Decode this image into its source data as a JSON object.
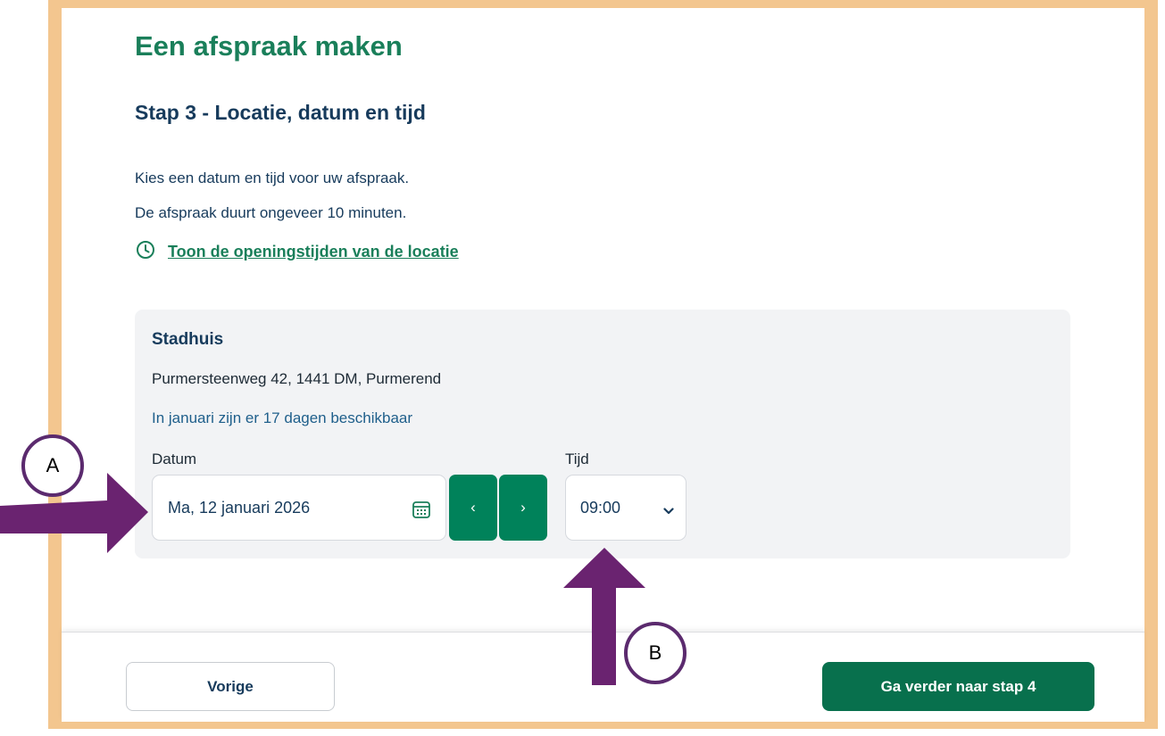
{
  "page": {
    "title": "Een afspraak maken",
    "step_title": "Stap 3 - Locatie, datum en tijd",
    "intro_lines": [
      "Kies een datum en tijd voor uw afspraak.",
      "De afspraak duurt ongeveer 10 minuten."
    ],
    "hours_link": "Toon de openingstijden van de locatie"
  },
  "location": {
    "name": "Stadhuis",
    "address": "Purmersteenweg 42, 1441 DM, Purmerend",
    "availability": "In januari zijn er 17 dagen beschikbaar"
  },
  "form": {
    "date_label": "Datum",
    "date_value": "Ma, 12 januari 2026",
    "prev_symbol": "‹",
    "next_symbol": "›",
    "time_label": "Tijd",
    "time_value": "09:00"
  },
  "footer": {
    "prev_label": "Vorige",
    "next_label": "Ga verder naar stap 4"
  },
  "annotations": {
    "a_label": "A",
    "b_label": "B"
  },
  "colors": {
    "frame": "#f3c68f",
    "brand_green": "#1a7f5a",
    "button_green": "#00825a",
    "heading_blue": "#173b5c",
    "annotation_purple": "#6a2370"
  },
  "icons": [
    "clock-icon",
    "calendar-icon",
    "chevron-left-icon",
    "chevron-right-icon",
    "chevron-down-icon",
    "arrow-right-icon",
    "arrow-up-icon"
  ]
}
